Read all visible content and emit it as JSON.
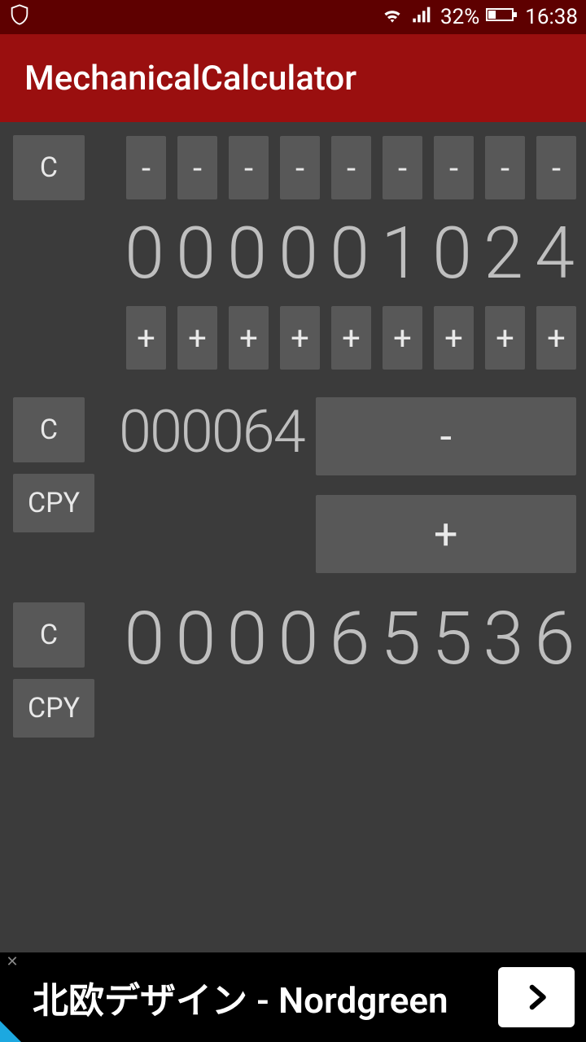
{
  "status": {
    "battery": "32%",
    "time": "16:38"
  },
  "app": {
    "title": "MechanicalCalculator"
  },
  "buttons": {
    "clear": "C",
    "copy": "CPY",
    "minus": "-",
    "plus": "+"
  },
  "register1": {
    "digits": [
      "0",
      "0",
      "0",
      "0",
      "0",
      "1",
      "0",
      "2",
      "4"
    ]
  },
  "register2": {
    "value": "000064"
  },
  "register3": {
    "digits": [
      "0",
      "0",
      "0",
      "0",
      "6",
      "5",
      "5",
      "3",
      "6"
    ]
  },
  "ad": {
    "text": "北欧デザイン - Nordgreen"
  }
}
